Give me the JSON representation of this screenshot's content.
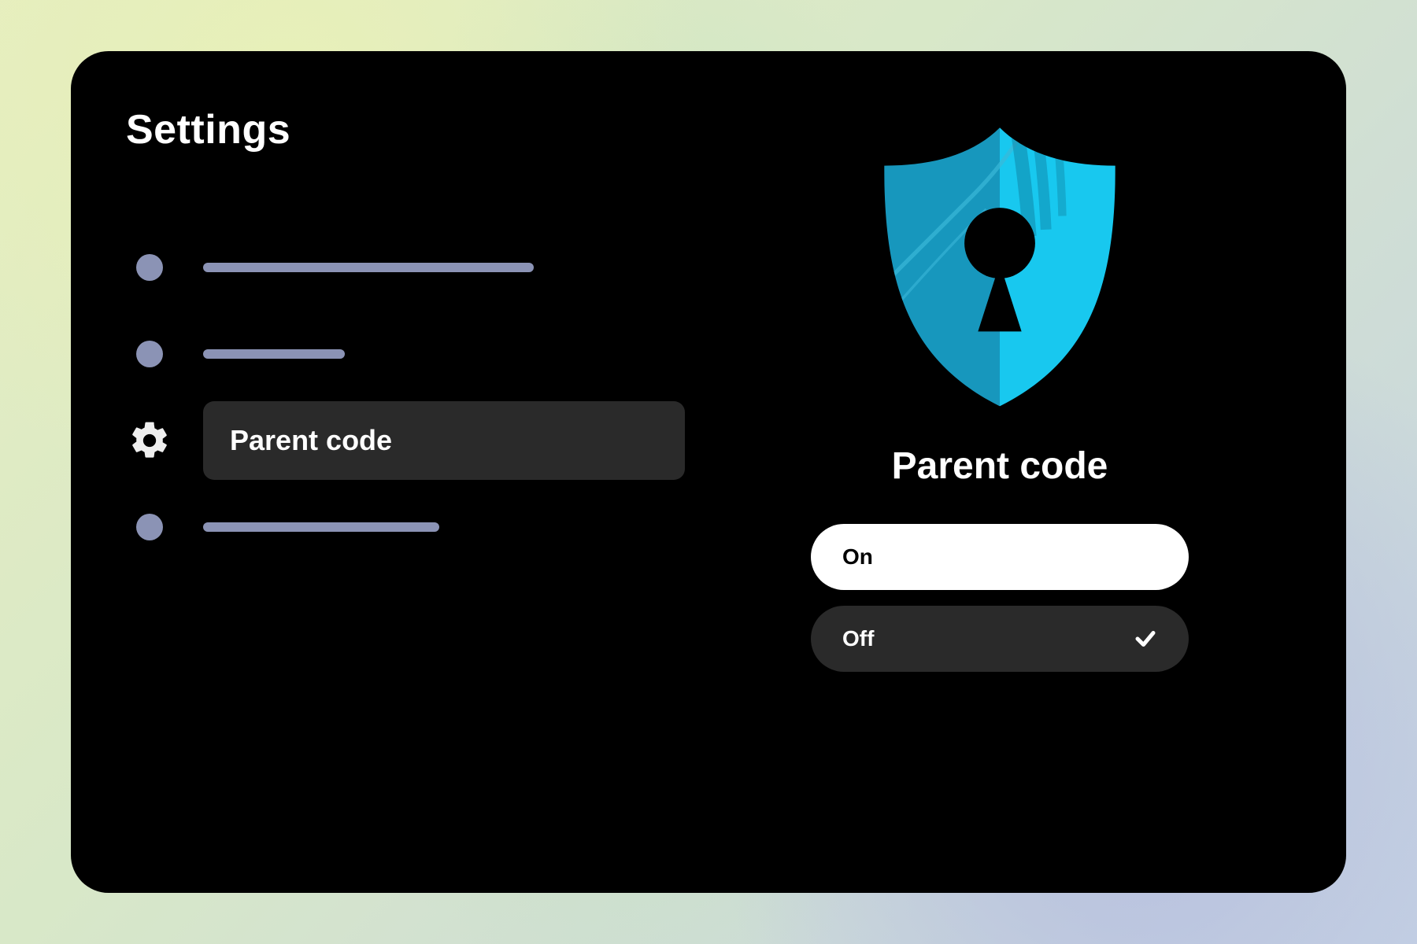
{
  "page_title": "Settings",
  "sidebar": {
    "items": [
      {
        "type": "placeholder"
      },
      {
        "type": "placeholder"
      },
      {
        "type": "item",
        "label": "Parent code",
        "selected": true
      },
      {
        "type": "placeholder"
      }
    ]
  },
  "detail": {
    "title": "Parent code",
    "options": [
      {
        "label": "On",
        "focused": true,
        "checked": false
      },
      {
        "label": "Off",
        "focused": false,
        "checked": true
      }
    ]
  },
  "icons": {
    "shield": "shield-lock-icon",
    "gear": "gear-icon",
    "check": "check-icon"
  },
  "colors": {
    "panel_bg": "#000000",
    "placeholder": "#8b93b5",
    "selected_bg": "#2a2a2a",
    "option_focused_bg": "#ffffff",
    "option_unfocused_bg": "#2a2a2a",
    "shield_left": "#1797bd",
    "shield_right": "#18c8ef"
  }
}
